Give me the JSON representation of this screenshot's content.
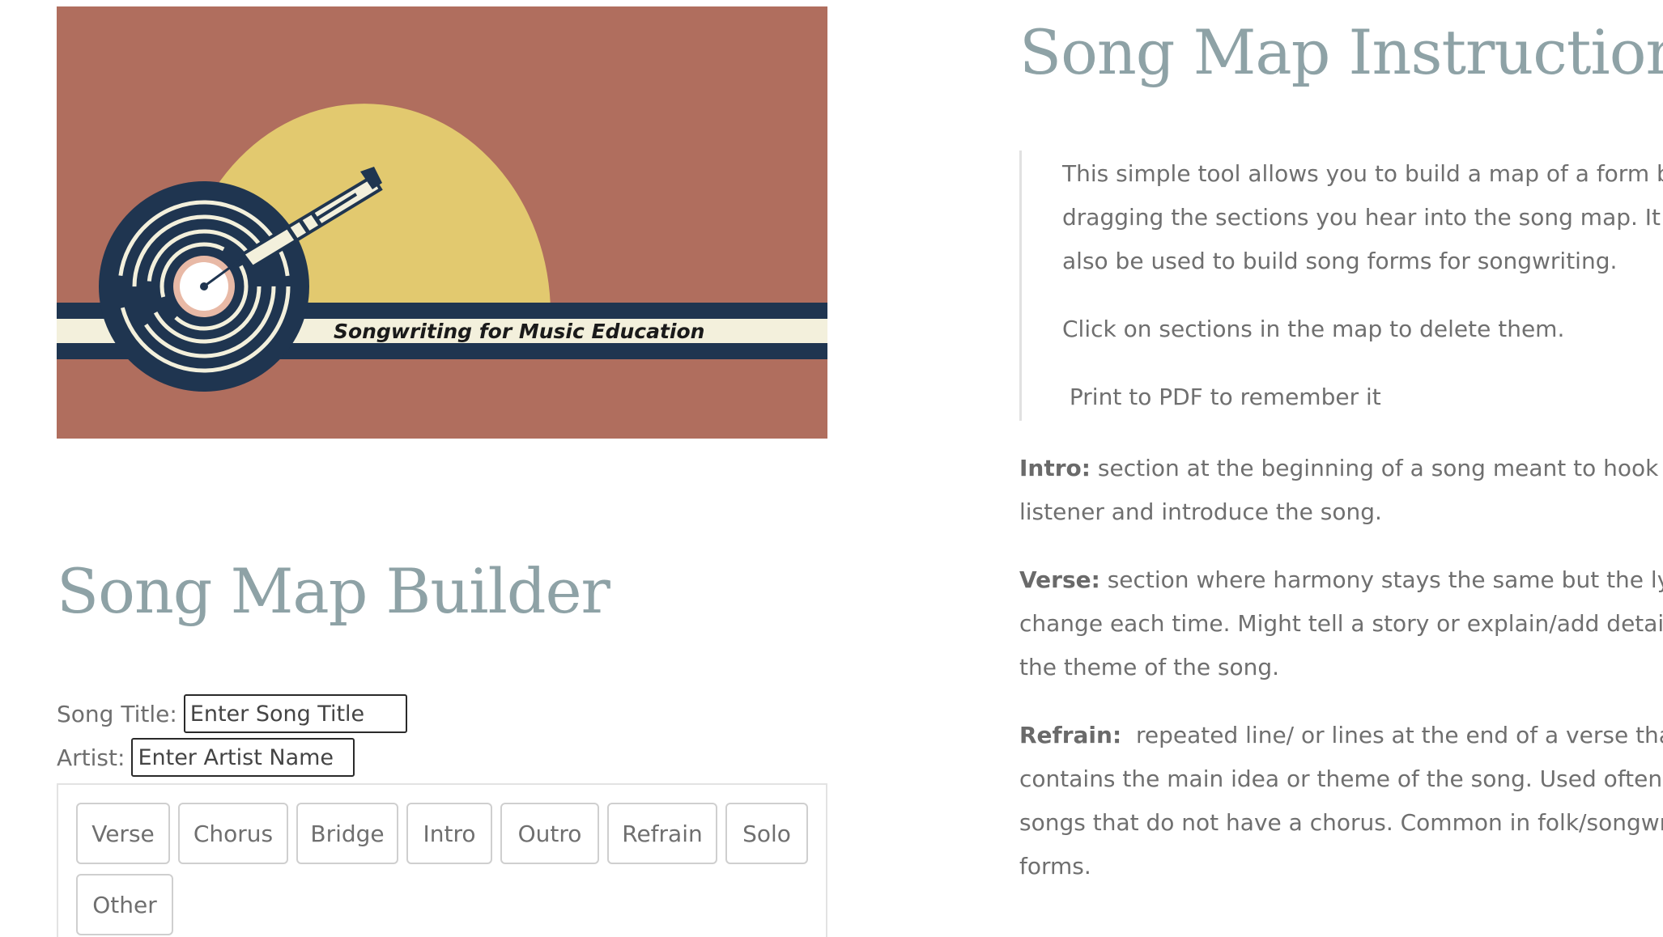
{
  "banner": {
    "caption": "Songwriting for Music Education",
    "colors": {
      "background": "#b06e5e",
      "sun": "#e2c96f",
      "stripe_dark": "#1f3550",
      "stripe_light": "#f3f0dc",
      "record": "#1f3550"
    }
  },
  "builder": {
    "title": "Song Map Builder",
    "song_title_label": "Song Title:",
    "song_title_placeholder": "Enter Song Title",
    "artist_label": "Artist:",
    "artist_placeholder": "Enter Artist Name",
    "sections": [
      "Verse",
      "Chorus",
      "Bridge",
      "Intro",
      "Outro",
      "Refrain",
      "Solo",
      "Other"
    ]
  },
  "instructions": {
    "title": "Song Map Instructions:",
    "quote": {
      "line1": "This simple tool allows you to build a map of a form by",
      "line2": "dragging the sections you hear into the song map.  It can",
      "line3": "also be used to build song forms for songwriting.",
      "line4": "Click on sections in the map to delete them.",
      "line5": " Print to PDF to remember it"
    },
    "intro": {
      "term": "Intro:",
      "line1": " section at the beginning of a song meant to hook the",
      "line2": "listener and introduce the song."
    },
    "verse": {
      "term": "Verse:",
      "line1": " section where harmony stays the same but the lyrics",
      "line2": "change each time. Might tell a story or explain/add detail to",
      "line3": "the theme of the song."
    },
    "refrain": {
      "term": "Refrain:",
      "line1": "  repeated line/ or lines at the end of a verse that",
      "line2": "contains the main idea or theme of the song. Used often in",
      "line3": "songs that do not have a chorus. Common in folk/songwriter",
      "line4": "forms."
    }
  }
}
